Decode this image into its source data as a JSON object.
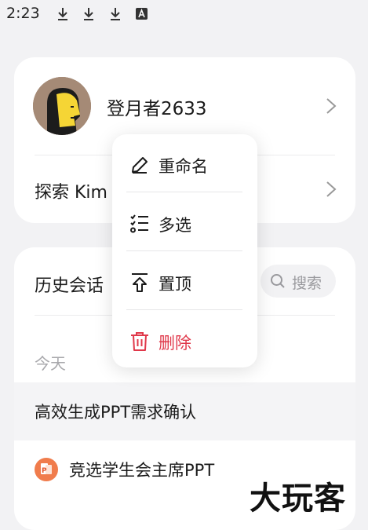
{
  "status_bar": {
    "time": "2:23",
    "icons": [
      "download-icon",
      "download-icon",
      "download-icon",
      "keyboard-a-icon"
    ]
  },
  "profile": {
    "username": "登月者2633",
    "explore_label": "探索 Kim"
  },
  "history": {
    "title": "历史会话",
    "search_placeholder": "搜索",
    "section_today": "今天",
    "conversations": [
      {
        "title": "高效生成PPT需求确认",
        "active": true
      },
      {
        "title": "竞选学生会主席PPT",
        "icon": "ppt-icon"
      }
    ]
  },
  "context_menu": {
    "items": [
      {
        "label": "重命名",
        "icon": "pencil-icon"
      },
      {
        "label": "多选",
        "icon": "checklist-icon"
      },
      {
        "label": "置顶",
        "icon": "pin-top-icon"
      },
      {
        "label": "删除",
        "icon": "trash-icon",
        "danger": true
      }
    ]
  },
  "watermark": "大玩客",
  "colors": {
    "background": "#f2f2f4",
    "card": "#ffffff",
    "danger": "#e0384a",
    "muted_text": "#a8a8ac"
  }
}
